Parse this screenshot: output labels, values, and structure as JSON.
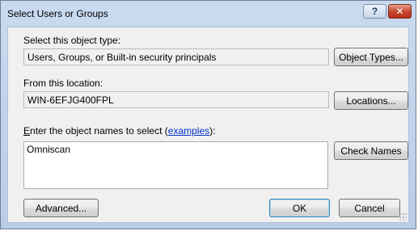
{
  "window": {
    "title": "Select Users or Groups",
    "help_glyph": "?",
    "close_glyph": "✕"
  },
  "object_type": {
    "label": "Select this object type:",
    "value": "Users, Groups, or Built-in security principals",
    "button": "Object Types..."
  },
  "location": {
    "label": "From this location:",
    "value": "WIN-6EFJG400FPL",
    "button": "Locations..."
  },
  "names": {
    "label_prefix_mnemonic": "E",
    "label_prefix_rest": "nter the object names to select (",
    "link": "examples",
    "label_suffix": "):",
    "value": "Omniscan",
    "check_button": "Check Names"
  },
  "footer": {
    "advanced_button": "Advanced...",
    "ok_button": "OK",
    "cancel_button": "Cancel"
  },
  "colors": {
    "frame": "#b9cde8",
    "close": "#c74a2f",
    "link": "#0033cc"
  }
}
